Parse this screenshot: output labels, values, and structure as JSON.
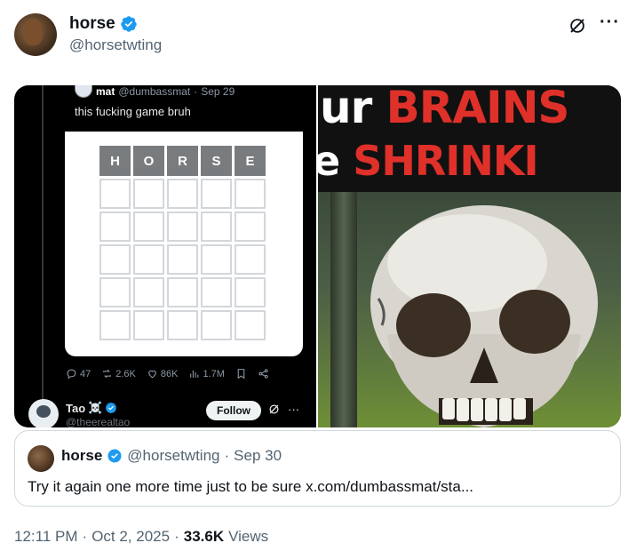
{
  "author": {
    "name": "horse",
    "handle": "@horsetwting"
  },
  "header_icons": {
    "grok": "grok-icon",
    "more": "···"
  },
  "media_left": {
    "quoted": {
      "name": "mat",
      "handle": "@dumbassmat",
      "date": "Sep 29",
      "text": "this fucking game bruh"
    },
    "grid": {
      "letters": [
        "H",
        "O",
        "R",
        "S",
        "E"
      ],
      "empty_rows": 5
    },
    "stats": {
      "replies": "47",
      "reposts": "2.6K",
      "likes": "86K",
      "views": "1.7M"
    },
    "reply": {
      "name": "Tao",
      "emoji": "☠️",
      "handle": "@theerealtao",
      "follow_label": "Follow",
      "more": "···"
    }
  },
  "media_right": {
    "line1_white": "ur ",
    "line1_red": "BRAINS",
    "line2_white": "e ",
    "line2_red": "SHRINKI"
  },
  "quote": {
    "name": "horse",
    "handle": "@horsetwting",
    "date": "Sep 30",
    "text": "Try it again one more time just to be sure x.com/dumbassmat/sta..."
  },
  "footer": {
    "time": "12:11 PM",
    "date": "Oct 2, 2025",
    "views_count": "33.6K",
    "views_label": "Views"
  },
  "colors": {
    "verified": "#1d9bf0",
    "accent_red": "#e0302a"
  }
}
